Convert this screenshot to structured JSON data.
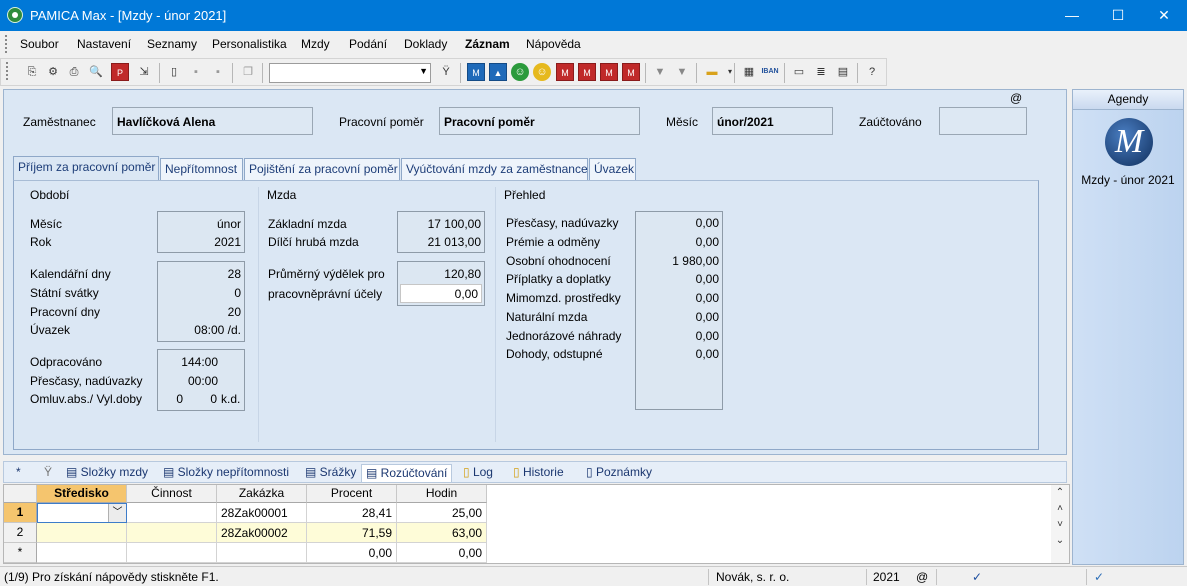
{
  "window": {
    "title": "PAMICA Max - [Mzdy - únor 2021]",
    "minimize": "—",
    "maximize": "☐",
    "close": "✕"
  },
  "menu": [
    "Soubor",
    "Nastavení",
    "Seznamy",
    "Personalistika",
    "Mzdy",
    "Podání",
    "Doklady",
    "Záznam",
    "Nápověda"
  ],
  "toolbar": {
    "combo_value": ""
  },
  "header": {
    "employee_label": "Zaměstnanec",
    "employee_value": "Havlíčková Alena",
    "relation_label": "Pracovní poměr",
    "relation_value": "Pracovní poměr",
    "month_label": "Měsíc",
    "month_value": "únor/2021",
    "accounted_label": "Zaúčtováno",
    "accounted_value": "",
    "at_sign": "@"
  },
  "tabs": [
    "Příjem za pracovní poměr",
    "Nepřítomnost",
    "Pojištění za pracovní poměr",
    "Vyúčtování mzdy za zaměstnance",
    "Úvazek"
  ],
  "obdobi": {
    "title": "Období",
    "mesic_label": "Měsíc",
    "mesic_value": "únor",
    "rok_label": "Rok",
    "rok_value": "2021",
    "kal_label": "Kalendářní dny",
    "kal_value": "28",
    "svatky_label": "Státní svátky",
    "svatky_value": "0",
    "prac_label": "Pracovní dny",
    "prac_value": "20",
    "uvazek_label": "Úvazek",
    "uvazek_value": "08:00 /d.",
    "odprac_label": "Odpracováno",
    "odprac_value": "144:00",
    "presc_label": "Přesčasy, nadúvazky",
    "presc_value": "00:00",
    "omluv_label": "Omluv.abs./ Vyl.doby",
    "omluv_value1": "0",
    "omluv_value2": "0",
    "omluv_unit": "k.d."
  },
  "mzda": {
    "title": "Mzda",
    "zakl_label": "Základní mzda",
    "zakl_value": "17 100,00",
    "dilci_label": "Dílčí hrubá mzda",
    "dilci_value": "21 013,00",
    "prum_label1": "Průměrný výdělek pro",
    "prum_label2": "pracovněprávní účely",
    "prum_value": "120,80",
    "prum_input": "0,00"
  },
  "prehled": {
    "title": "Přehled",
    "rows": [
      {
        "label": "Přesčasy, nadúvazky",
        "value": "0,00"
      },
      {
        "label": "Prémie a odměny",
        "value": "0,00"
      },
      {
        "label": "Osobní ohodnocení",
        "value": "1 980,00"
      },
      {
        "label": "Příplatky a doplatky",
        "value": "0,00"
      },
      {
        "label": "Mimomzd. prostředky",
        "value": "0,00"
      },
      {
        "label": "Naturální mzda",
        "value": "0,00"
      },
      {
        "label": "Jednorázové náhrady",
        "value": "0,00"
      },
      {
        "label": "Dohody, odstupné",
        "value": "0,00"
      }
    ]
  },
  "agendy": {
    "header": "Agendy",
    "item": "Mzdy - únor 2021",
    "logo_letter": "M"
  },
  "bottom_tabs": [
    "*",
    "Složky mzdy",
    "Složky nepřítomnosti",
    "Srážky",
    "Rozúčtování",
    "Log",
    "Historie",
    "Poznámky"
  ],
  "grid": {
    "columns": [
      "Středisko",
      "Činnost",
      "Zakázka",
      "Procent",
      "Hodin"
    ],
    "rows": [
      {
        "hdr": "1",
        "stredisko": "",
        "cinnost": "",
        "zakazka": "28Zak00001",
        "procent": "28,41",
        "hodin": "25,00"
      },
      {
        "hdr": "2",
        "stredisko": "",
        "cinnost": "",
        "zakazka": "28Zak00002",
        "procent": "71,59",
        "hodin": "63,00"
      },
      {
        "hdr": "*",
        "stredisko": "",
        "cinnost": "",
        "zakazka": "",
        "procent": "0,00",
        "hodin": "0,00"
      }
    ]
  },
  "status": {
    "help": "(1/9) Pro získání nápovědy stiskněte F1.",
    "company": "Novák, s. r. o.",
    "year": "2021",
    "at": "@"
  }
}
